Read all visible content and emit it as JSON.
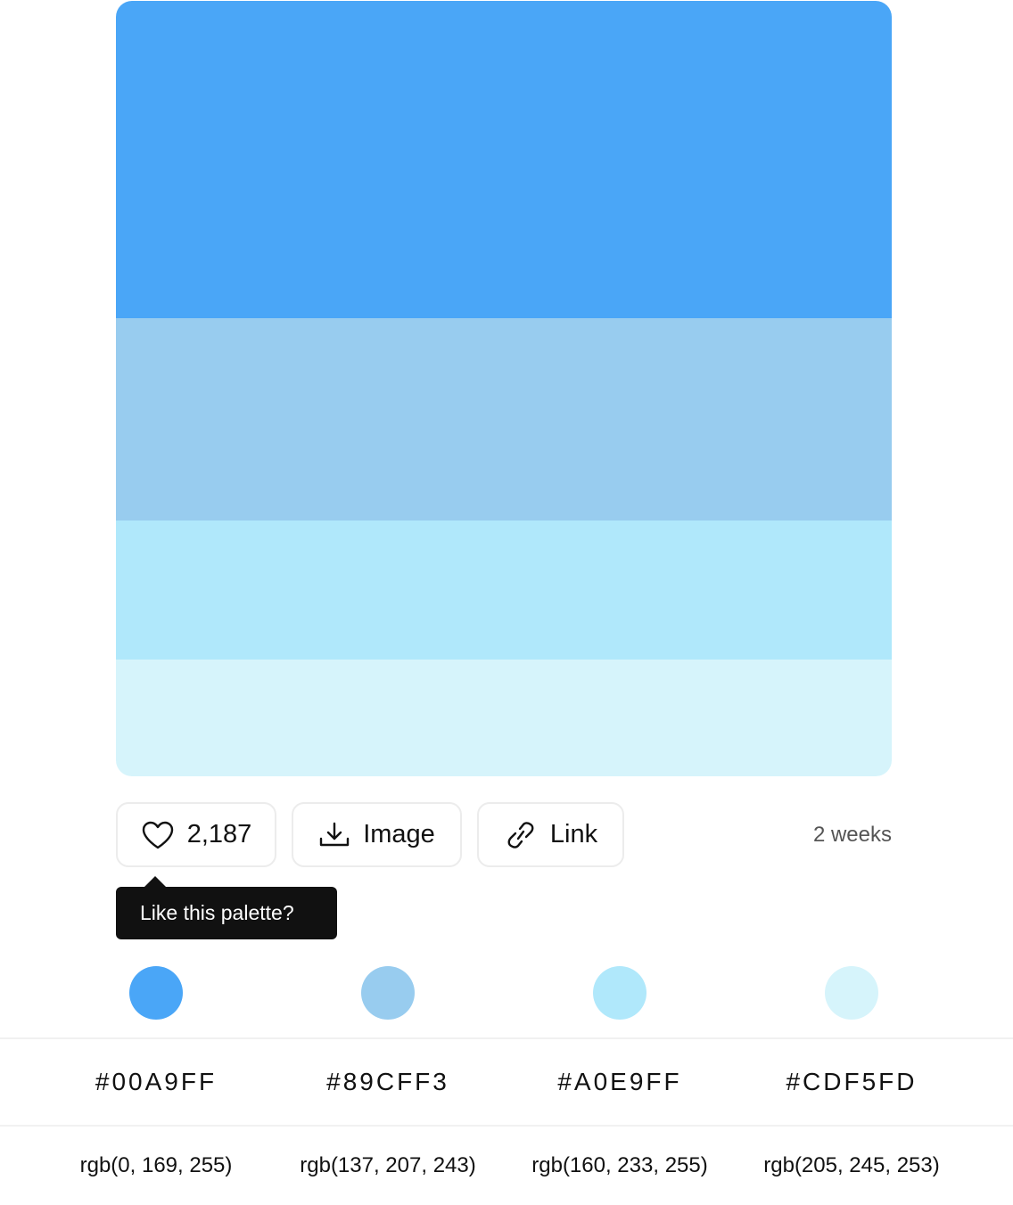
{
  "palette": {
    "swatches": [
      {
        "color": "#4AA6F7"
      },
      {
        "color": "#98CCEF"
      },
      {
        "color": "#B0E8FB"
      },
      {
        "color": "#D6F4FB"
      }
    ]
  },
  "actions": {
    "like_count": "2,187",
    "image_label": "Image",
    "link_label": "Link",
    "time_ago": "2 weeks"
  },
  "tooltip": {
    "text": "Like this palette?"
  },
  "colors": [
    {
      "dot_color": "#4AA6F7",
      "hex": "#00A9FF",
      "rgb": "rgb(0, 169, 255)"
    },
    {
      "dot_color": "#98CCEF",
      "hex": "#89CFF3",
      "rgb": "rgb(137, 207, 243)"
    },
    {
      "dot_color": "#B0E8FB",
      "hex": "#A0E9FF",
      "rgb": "rgb(160, 233, 255)"
    },
    {
      "dot_color": "#D6F4FB",
      "hex": "#CDF5FD",
      "rgb": "rgb(205, 245, 253)"
    }
  ],
  "icons": {
    "like": "heart-icon",
    "image": "download-icon",
    "link": "link-icon"
  }
}
